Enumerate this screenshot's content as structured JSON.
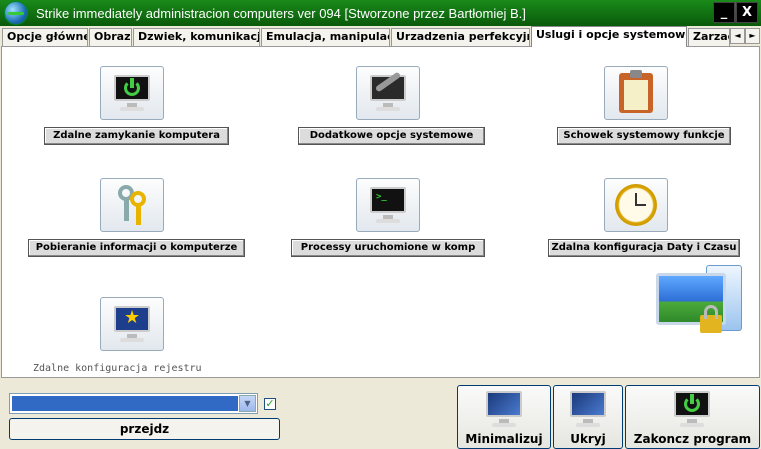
{
  "window": {
    "title": "Strike immediately administracion computers ver 094 [Stworzone przez Bartłomiej B.]",
    "minimize_label": "_",
    "close_label": "X"
  },
  "tabs": [
    {
      "label": "Opcje główne"
    },
    {
      "label": "Obraz"
    },
    {
      "label": "Dzwiek, komunikacja"
    },
    {
      "label": "Emulacja, manipulacja"
    },
    {
      "label": "Urzadzenia perfekcyjne"
    },
    {
      "label": "Uslugi i opcje systemowe",
      "active": true
    },
    {
      "label": "Zarzad"
    }
  ],
  "tab_scroll": {
    "left": "◄",
    "right": "►"
  },
  "tools": {
    "remote_shutdown": {
      "label": "Zdalne zamykanie komputera",
      "icon": "power-monitor-icon"
    },
    "extra_system_options": {
      "label": "Dodatkowe opcje systemowe",
      "icon": "wrench-monitor-icon"
    },
    "system_clipboard": {
      "label": "Schowek systemowy funkcje",
      "icon": "clipboard-icon"
    },
    "computer_info": {
      "label": "Pobieranie informacji o komputerze",
      "icon": "keys-icon"
    },
    "running_processes": {
      "label": "Processy uruchomione w komp",
      "icon": "terminal-monitor-icon"
    },
    "remote_datetime": {
      "label": "Zdalna konfiguracja Daty i Czasu",
      "icon": "clock-icon"
    },
    "remote_registry": {
      "label": "Zdalne konfiguracja rejestru",
      "icon": "star-monitor-icon"
    }
  },
  "bottom": {
    "combo_value": "",
    "checkbox_checked": true,
    "go_label": "przejdz",
    "minimize_label": "Minimalizuj",
    "hide_label": "Ukryj",
    "exit_label": "Zakoncz program"
  },
  "colors": {
    "titlebar": "#0a6a0a",
    "selection": "#316ac5",
    "power_green": "#44cc44"
  }
}
